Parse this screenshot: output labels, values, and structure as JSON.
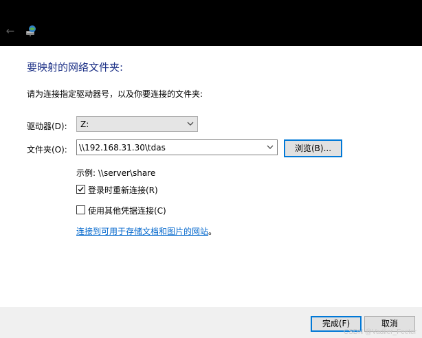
{
  "window": {
    "back_icon": "back-arrow-icon",
    "app_icon": "network-drive-icon"
  },
  "page": {
    "heading": "要映射的网络文件夹:",
    "instruction": "请为连接指定驱动器号，以及你要连接的文件夹:"
  },
  "drive": {
    "label": "驱动器(D):",
    "value": "Z:"
  },
  "folder": {
    "label": "文件夹(O):",
    "value": "\\\\192.168.31.30\\tdas",
    "browse_label": "浏览(B)..."
  },
  "example": "示例: \\\\server\\share",
  "options": {
    "reconnect": {
      "label": "登录时重新连接(R)",
      "checked": true
    },
    "other_credentials": {
      "label": "使用其他凭据连接(C)",
      "checked": false
    }
  },
  "link": {
    "text": "连接到可用于存储文档和图片的网站",
    "suffix": "。"
  },
  "footer": {
    "finish_label": "完成(F)",
    "cancel_label": "取消"
  },
  "watermark": "CSDN @Vadiler_Feeter",
  "colors": {
    "heading": "#1e3287",
    "accent": "#0078d7",
    "link": "#0066cc"
  }
}
